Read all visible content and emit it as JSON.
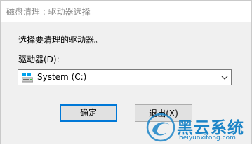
{
  "window": {
    "title": "磁盘清理 : 驱动器选择"
  },
  "dialog": {
    "prompt": "选择要清理的驱动器。",
    "drive_label": "驱动器(D):",
    "drive_select": {
      "selected": "System (C:)",
      "icon": "drive-icon"
    },
    "ok_label": "确定",
    "exit_label": "退出(X)"
  },
  "watermark": {
    "brand": "黑云系统",
    "url": "heiyunxitong.com"
  },
  "colors": {
    "focus_border": "#0078d7",
    "watermark_blue": "#1c84c7"
  }
}
